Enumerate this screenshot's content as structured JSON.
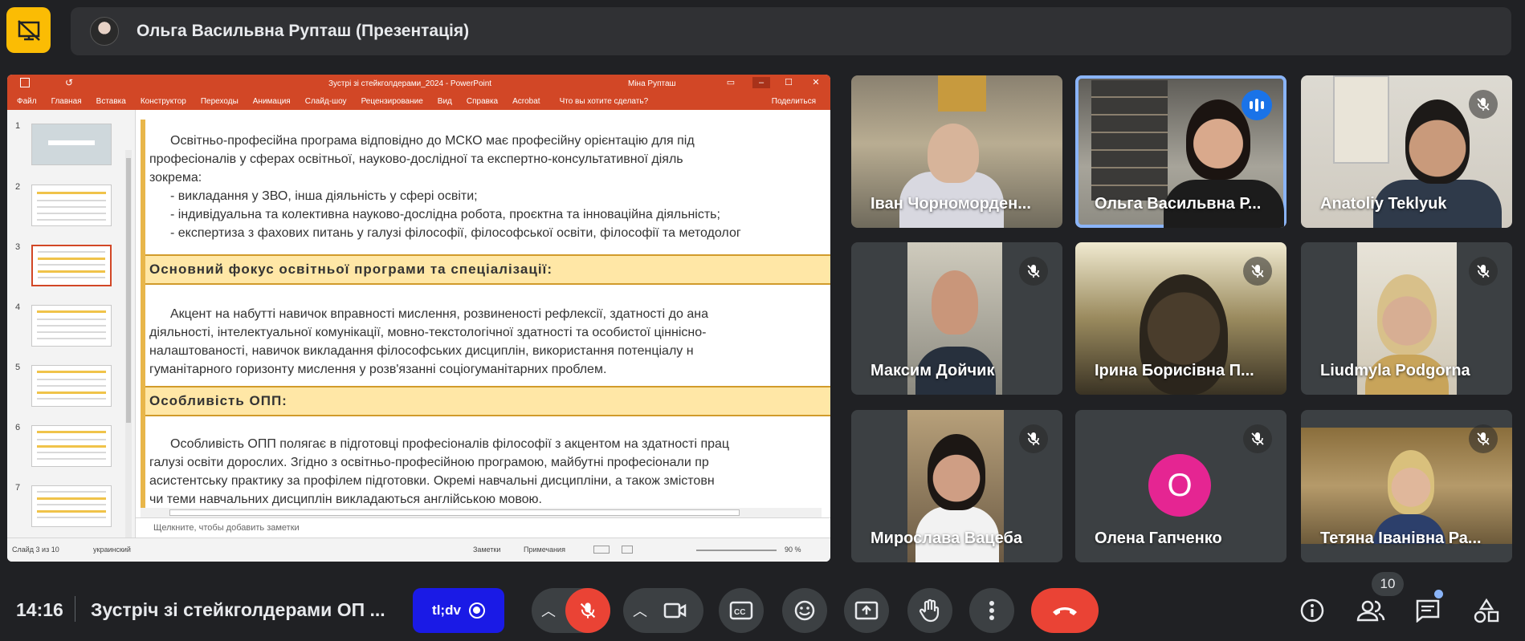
{
  "header": {
    "presenter_title": "Ольга Васильвна Рупташ (Презентація)"
  },
  "presentation": {
    "window_title": "Зустрі зі стейкголдерами_2024 - PowerPoint",
    "user": "Міна Рупташ",
    "ribbon": [
      "Файл",
      "Главная",
      "Вставка",
      "Конструктор",
      "Переходы",
      "Анимация",
      "Слайд-шоу",
      "Рецензирование",
      "Вид",
      "Справка",
      "Acrobat"
    ],
    "tell_me": "Что вы хотите сделать?",
    "share": "Поделиться",
    "thumb_numbers": [
      "1",
      "2",
      "3",
      "4",
      "5",
      "6",
      "7"
    ],
    "slide_lines": [
      "Освітньо-професійна програма відповідно до МСКО має професійну орієнтацію для під",
      "професіоналів у сферах освітньої, науково-дослідної та експертно-консультативної діяль",
      "зокрема:",
      "- викладання у ЗВО, інша діяльність у сфері освіти;",
      "- індивідуальна та колективна науково-дослідна робота, проєктна та інноваційна діяльність;",
      "- експертиза з фахових питань у галузі філософії, філософської освіти, філософії та методолог"
    ],
    "heading1": "Основний фокус освітньої програми та спеціалізації:",
    "focus_lines": [
      "Акцент на набутті навичок вправності мислення, розвиненості рефлексії, здатності до ана",
      "діяльності, інтелектуальної комунікації, мовно-текстологічної здатності та особистої ціннісно-",
      "налаштованості, навичок викладання філософських дисциплін, використання потенціалу н",
      "гуманітарного горизонту мислення у розв'язанні соціогуманітарних проблем."
    ],
    "heading2": "Особливість ОПП:",
    "feature_lines": [
      "Особливість ОПП полягає в підготовці професіоналів філософії з акцентом на здатності прац",
      "галузі освіти дорослих. Згідно з освітньо-професійною програмою, майбутні професіонали пр",
      "асистентську практику за профілем підготовки. Окремі навчальні дисципліни, а також змістовн",
      "чи теми навчальних дисциплін викладаються англійською мовою."
    ],
    "notes_placeholder": "Щелкните, чтобы добавить заметки",
    "status_slide": "Слайд 3 из 10",
    "status_lang": "украинский",
    "status_notes": "Заметки",
    "status_comments": "Примечания",
    "zoom": "90 %"
  },
  "participants": [
    {
      "name": "Іван Чорноморден...",
      "muted": false
    },
    {
      "name": "Ольга Васильвна Р...",
      "muted": false,
      "speaking": true
    },
    {
      "name": "Anatoliy Teklyuk",
      "muted": true
    },
    {
      "name": "Максим Дойчик",
      "muted": true
    },
    {
      "name": "Ірина Борисівна П...",
      "muted": true
    },
    {
      "name": "Liudmyla Podgorna",
      "muted": true
    },
    {
      "name": "Мирослава Вацеба",
      "muted": true
    },
    {
      "name": "Олена Гапченко",
      "muted": true,
      "initial": "О"
    },
    {
      "name": "Тетяна Іванівна Ра...",
      "muted": true
    }
  ],
  "bottom": {
    "time": "14:16",
    "meeting_title": "Зустріч зі стейкголдерами ОП ...",
    "activity_label": "tl;dv",
    "people_count": "10"
  },
  "colors": {
    "background": "#202124",
    "end_call": "#ea4335",
    "mic_off": "#ea4335",
    "accent": "#8ab4f8"
  }
}
